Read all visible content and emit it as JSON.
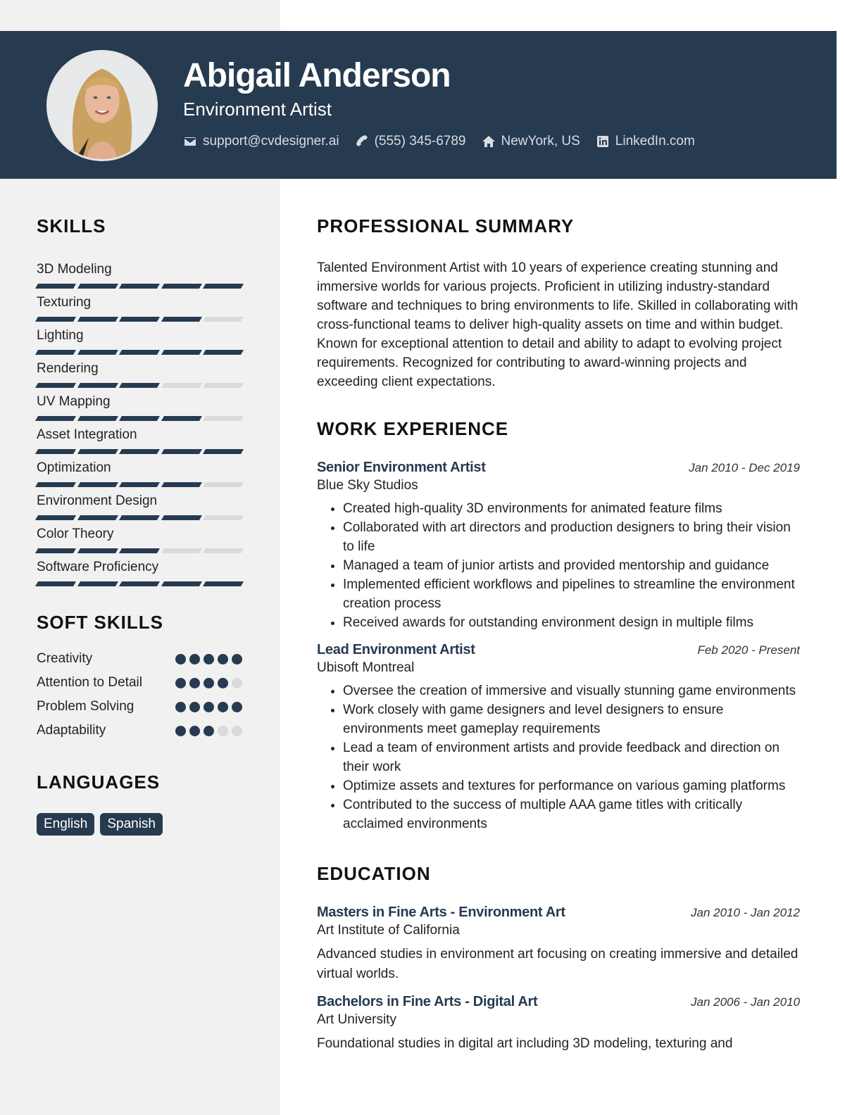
{
  "header": {
    "name": "Abigail Anderson",
    "title": "Environment Artist",
    "photo_alt": "Profile photo",
    "contacts": [
      {
        "icon": "envelope-icon",
        "text": "support@cvdesigner.ai"
      },
      {
        "icon": "phone-icon",
        "text": "(555) 345-6789"
      },
      {
        "icon": "home-icon",
        "text": "NewYork, US"
      },
      {
        "icon": "linkedin-icon",
        "text": "LinkedIn.com"
      }
    ]
  },
  "colors": {
    "accent": "#263a50",
    "sidebar_bg": "#f1f1f1",
    "inactive": "#dadada"
  },
  "skills": {
    "title": "SKILLS",
    "max": 5,
    "items": [
      {
        "name": "3D Modeling",
        "level": 5
      },
      {
        "name": "Texturing",
        "level": 4
      },
      {
        "name": "Lighting",
        "level": 5
      },
      {
        "name": "Rendering",
        "level": 3
      },
      {
        "name": "UV Mapping",
        "level": 4
      },
      {
        "name": "Asset Integration",
        "level": 5
      },
      {
        "name": "Optimization",
        "level": 4
      },
      {
        "name": "Environment Design",
        "level": 4
      },
      {
        "name": "Color Theory",
        "level": 3
      },
      {
        "name": "Software Proficiency",
        "level": 5
      }
    ]
  },
  "soft_skills": {
    "title": "SOFT SKILLS",
    "max": 5,
    "items": [
      {
        "name": "Creativity",
        "level": 5
      },
      {
        "name": "Attention to Detail",
        "level": 4
      },
      {
        "name": "Problem Solving",
        "level": 5
      },
      {
        "name": "Adaptability",
        "level": 3
      }
    ]
  },
  "languages": {
    "title": "LANGUAGES",
    "items": [
      "English",
      "Spanish"
    ]
  },
  "summary": {
    "title": "PROFESSIONAL SUMMARY",
    "text": "Talented Environment Artist with 10 years of experience creating stunning and immersive worlds for various projects. Proficient in utilizing industry-standard software and techniques to bring environments to life. Skilled in collaborating with cross-functional teams to deliver high-quality assets on time and within budget. Known for exceptional attention to detail and ability to adapt to evolving project requirements. Recognized for contributing to award-winning projects and exceeding client expectations."
  },
  "work": {
    "title": "WORK EXPERIENCE",
    "jobs": [
      {
        "role": "Senior Environment Artist",
        "company": "Blue Sky Studios",
        "dates": "Jan 2010 - Dec 2019",
        "bullets": [
          "Created high-quality 3D environments for animated feature films",
          "Collaborated with art directors and production designers to bring their vision to life",
          "Managed a team of junior artists and provided mentorship and guidance",
          "Implemented efficient workflows and pipelines to streamline the environment creation process",
          "Received awards for outstanding environment design in multiple films"
        ]
      },
      {
        "role": "Lead Environment Artist",
        "company": "Ubisoft Montreal",
        "dates": "Feb 2020 - Present",
        "bullets": [
          "Oversee the creation of immersive and visually stunning game environments",
          "Work closely with game designers and level designers to ensure environments meet gameplay requirements",
          "Lead a team of environment artists and provide feedback and direction on their work",
          "Optimize assets and textures for performance on various gaming platforms",
          "Contributed to the success of multiple AAA game titles with critically acclaimed environments"
        ]
      }
    ]
  },
  "education": {
    "title": "EDUCATION",
    "items": [
      {
        "degree": "Masters in Fine Arts - Environment Art",
        "school": "Art Institute of California",
        "dates": "Jan 2010 - Jan 2012",
        "description": "Advanced studies in environment art focusing on creating immersive and detailed virtual worlds."
      },
      {
        "degree": "Bachelors in Fine Arts - Digital Art",
        "school": "Art University",
        "dates": "Jan 2006 - Jan 2010",
        "description": "Foundational studies in digital art including 3D modeling, texturing and"
      }
    ]
  }
}
